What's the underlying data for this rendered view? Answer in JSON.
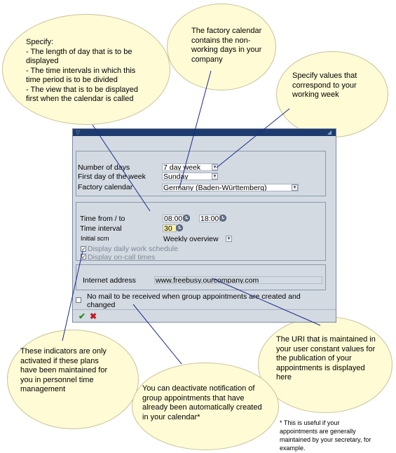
{
  "callouts": {
    "specify": "Specify:\n- The length of day that is to be\ndisplayed\n- The time intervals in which this\ntime period is to be divided\n- The view that is to be displayed\nfirst when the calendar is called",
    "factory_calendar": "The factory calendar\ncontains the non-\nworking days in your\ncompany",
    "working_week": "Specify values that\ncorrespond to your\nworking week",
    "indicators": "These indicators are only\nactivated if these plans\nhave been maintained for\nyou in personnel time\nmanagement",
    "uri": "The URI that is maintained in\nyour user constant values for\nthe publication of your\nappointments is displayed\nhere",
    "notification": "You can deactivate notification of\ngroup appointments that have\nalready been automatically created\nin your calendar*",
    "footnote": "* This is useful if your\nappointments are generally\nmaintained by your secretary, for\nexample."
  },
  "form": {
    "number_of_days_label": "Number of days",
    "number_of_days_value": "7 day week",
    "first_day_label": "First day of the week",
    "first_day_value": "Sunday",
    "factory_calendar_label": "Factory calendar",
    "factory_calendar_value": "Germany (Baden-Württemberg)",
    "time_from_to_label": "Time from / to",
    "time_from": "08:00",
    "time_to": "18:00",
    "time_interval_label": "Time interval",
    "time_interval_value": "30",
    "initial_scrn_label": "Initial scrn",
    "initial_scrn_value": "Weekly overview",
    "display_daily_work_schedule": "Display daily work schedule",
    "display_on_call_times": "Display on-call times",
    "internet_address_label": "Internet address",
    "internet_address_value": "www.freebusy.ourcompany.com",
    "no_mail_label": "No mail to be received when group appointments are created and\nchanged"
  },
  "icons": {
    "confirm": "check-icon",
    "cancel": "cross-icon",
    "dropdown": "dropdown-arrow-icon",
    "clock": "clock-icon"
  },
  "colors": {
    "callout_fill": "#fffbd5",
    "window_bg": "#d3dae2",
    "title_bar": "#1d3b6e",
    "connector": "#1a2b8c",
    "highlight_field": "#fff2a8",
    "confirm_green": "#2d8a1f",
    "cancel_red": "#c2161d"
  }
}
